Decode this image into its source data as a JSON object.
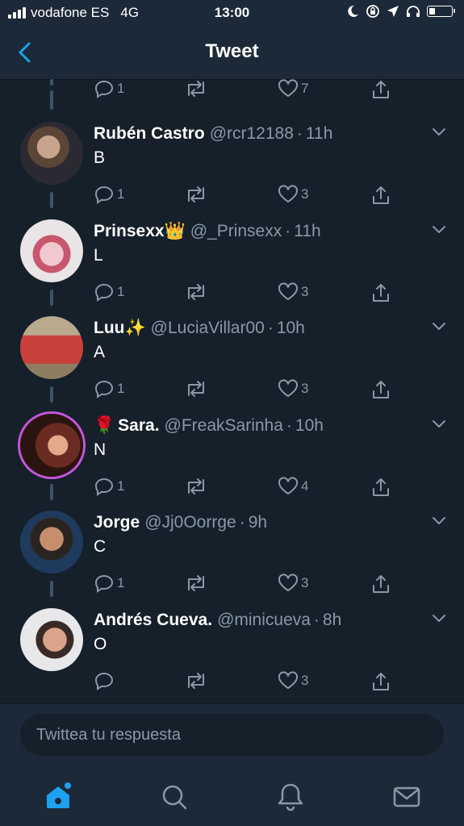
{
  "status": {
    "carrier": "vodafone ES",
    "network": "4G",
    "time": "13:00",
    "battery_level": 0.25
  },
  "nav": {
    "title": "Tweet",
    "back_icon": "chevron-left-icon"
  },
  "colors": {
    "accent": "#1da1f2",
    "background": "#15202b",
    "bar": "#1c2938",
    "muted": "#8899a6"
  },
  "top_actions": {
    "replies": "1",
    "likes": "7"
  },
  "tweets": [
    {
      "name": "Rubén Castro",
      "emoji": "",
      "handle": "@rcr12188",
      "time": "11h",
      "text": "B",
      "replies": "1",
      "likes": "3"
    },
    {
      "name": "Prinsexx",
      "emoji": "👑",
      "handle": "@_Prinsexx",
      "time": "11h",
      "text": "L",
      "replies": "1",
      "likes": "3"
    },
    {
      "name": "Luu",
      "emoji": "✨",
      "handle": "@LuciaVillar00",
      "time": "10h",
      "text": "A",
      "replies": "1",
      "likes": "3"
    },
    {
      "name": "Sara.",
      "emoji": "🌹",
      "handle": "@FreakSarinha",
      "time": "10h",
      "text": "N",
      "replies": "1",
      "likes": "4"
    },
    {
      "name": "Jorge",
      "emoji": "",
      "handle": "@Jj0Oorrge",
      "time": "9h",
      "text": "C",
      "replies": "1",
      "likes": "3"
    },
    {
      "name": "Andrés Cueva.",
      "emoji": "",
      "handle": "@minicueva",
      "time": "8h",
      "text": "O",
      "replies": "",
      "likes": "3"
    }
  ],
  "reply": {
    "placeholder": "Twittea tu respuesta"
  },
  "tabs": [
    "home-icon",
    "search-icon",
    "bell-icon",
    "mail-icon"
  ]
}
